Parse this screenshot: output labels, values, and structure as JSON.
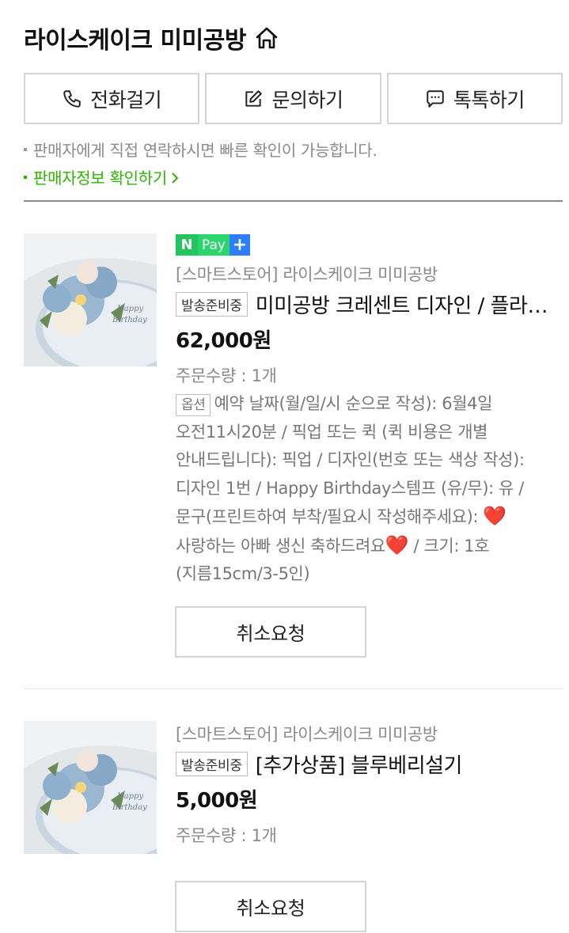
{
  "store": {
    "name": "라이스케이크 미미공방"
  },
  "contact": {
    "call": "전화걸기",
    "inquiry": "문의하기",
    "talk": "톡톡하기"
  },
  "notice": {
    "line1": "판매자에게 직접 연락하시면 빠른 확인이 가능합니다.",
    "line2": "판매자정보 확인하기"
  },
  "orders": [
    {
      "npay": {
        "n": "N",
        "pay": "Pay",
        "plus": "+"
      },
      "seller": "[스마트스토어] 라이스케이크 미미공방",
      "status": "발송준비중",
      "name": "미미공방 크레센트 디자인 / 플라워케이크",
      "price": "62,000원",
      "quantity": "주문수량 : 1개",
      "option_label": "옵션",
      "option_part1": "예약 날짜(월/일/시 순으로 작성): 6월4일 오전11시20분 / 픽업 또는 퀵 (퀵 비용은 개별 안내드립니다): 픽업 / 디자인(번호 또는 색상 작성): 디자인 1번 / Happy Birthday스템프 (유/무): 유 / 문구(프린트하여 부착/필요시 작성해주세요): ",
      "heart": "❤️",
      "option_part2": "사랑하는 아빠 생신 축하드려요",
      "option_part3": " / 크기: 1호(지름15cm/3-5인)",
      "cancel": "취소요청"
    },
    {
      "seller": "[스마트스토어] 라이스케이크 미미공방",
      "status": "발송준비중",
      "name": "[추가상품] 블루베리설기",
      "price": "5,000원",
      "quantity": "주문수량 : 1개",
      "cancel": "취소요청"
    }
  ],
  "icons": [
    "home-icon",
    "phone-icon",
    "edit-icon",
    "chat-icon"
  ],
  "colors": {
    "accent_green": "#2db400",
    "npay_green": "#2bd56c",
    "npay_blue": "#2d7ff9"
  }
}
